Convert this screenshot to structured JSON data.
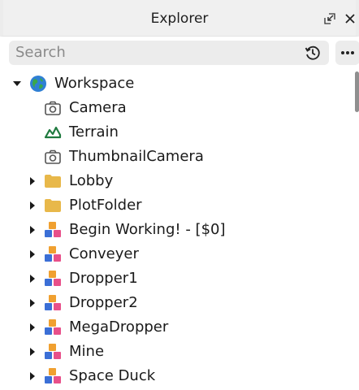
{
  "panel": {
    "title": "Explorer",
    "undock_icon": "undock-icon",
    "close_icon": "close-icon"
  },
  "search": {
    "placeholder": "Search",
    "history_icon": "history-icon",
    "more_icon": "more-icon"
  },
  "tree": {
    "root": {
      "label": "Workspace",
      "icon": "workspace-globe-icon",
      "expanded": true
    },
    "children": [
      {
        "label": "Camera",
        "icon": "camera-icon",
        "has_children": false
      },
      {
        "label": "Terrain",
        "icon": "terrain-icon",
        "has_children": false
      },
      {
        "label": "ThumbnailCamera",
        "icon": "camera-icon",
        "has_children": false
      },
      {
        "label": "Lobby",
        "icon": "folder-icon",
        "has_children": true
      },
      {
        "label": "PlotFolder",
        "icon": "folder-icon",
        "has_children": true
      },
      {
        "label": "Begin Working! - [$0]",
        "icon": "model-icon",
        "has_children": true
      },
      {
        "label": "Conveyer",
        "icon": "model-icon",
        "has_children": true
      },
      {
        "label": "Dropper1",
        "icon": "model-icon",
        "has_children": true
      },
      {
        "label": "Dropper2",
        "icon": "model-icon",
        "has_children": true
      },
      {
        "label": "MegaDropper",
        "icon": "model-icon",
        "has_children": true
      },
      {
        "label": "Mine",
        "icon": "model-icon",
        "has_children": true
      },
      {
        "label": "Space Duck",
        "icon": "model-icon",
        "has_children": true
      }
    ]
  },
  "colors": {
    "folder": "#e8b84a",
    "terrain": "#1f7a3f",
    "model_blue": "#3b6fd6",
    "model_pink": "#e8508a",
    "model_orange": "#f0a030",
    "globe_blue": "#2f7fd4",
    "globe_green": "#3aa84a"
  }
}
